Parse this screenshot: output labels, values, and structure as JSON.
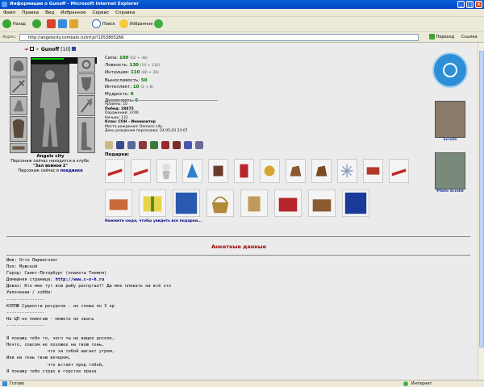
{
  "window": {
    "title": "Информация о Gunoff - Microsoft Internet Explorer"
  },
  "menu": [
    "Файл",
    "Правка",
    "Вид",
    "Избранное",
    "Сервис",
    "Справка"
  ],
  "toolbar": {
    "back": "Назад",
    "search": "Поиск",
    "favorites": "Избранное"
  },
  "address": {
    "label": "Адрес:",
    "url": "http://angelscity.combats.ru/inf.pl?1053803266",
    "go": "Переход",
    "links": "Ссылки"
  },
  "character": {
    "name": "Gunoff",
    "level": "[10]",
    "city": "Angels city",
    "club_line": "Персонаж сейчас находится в клубе.",
    "club_room": "\"Зал воинов 2\"",
    "location_line": "Персонаж сейчас в",
    "location_link": "поединке"
  },
  "stats": [
    {
      "label": "Сила:",
      "value": "100",
      "extra": "(62 + 38)"
    },
    {
      "label": "Ловкость:",
      "value": "130",
      "extra": "(14 + 116)"
    },
    {
      "label": "Интуиция:",
      "value": "110",
      "extra": "(80 + 30)"
    },
    {
      "label": "Выносливость:",
      "value": "50",
      "extra": ""
    },
    {
      "label": "Интеллект:",
      "value": "10",
      "extra": "(2 + 8)"
    },
    {
      "label": "Мудрость:",
      "value": "0",
      "extra": ""
    },
    {
      "label": "Духовность:",
      "value": "5",
      "extra": ""
    }
  ],
  "info": {
    "level": "Уровень: 10",
    "wins": "Побед: 28875",
    "losses": "Поражений: 3746",
    "draws": "Ничьих: 131",
    "clan": "Клан: COH - Инквизитор",
    "birthplace": "Место рождения: Demons city",
    "birthday": "День рождения персонажа: 24.05.03 23:07"
  },
  "gifts": {
    "label": "Подарки:",
    "link": "Нажмите сюда, чтобы увидеть все подарки..."
  },
  "rightpanel": {
    "scrolls": "Scrolls",
    "photo": "Photo Scrolls"
  },
  "anketa": {
    "title": "Анкетные данные",
    "name": "Имя: Отто Ларинголог",
    "sex": "Пол: Мужской",
    "city": "Город: Санкт-Петербург (планета Тнемля)",
    "homepage_label": "Домашняя страница: ",
    "homepage": "http://www.c-o-h.ru",
    "motto": "Девиз: Кто мне тут всю рыбу распугал?! Да мне плевать на всё это",
    "hobby": "Увлечения / хобби:",
    "lines": [
      "---------------",
      "КУПЛЮ Сущности ресурсов - не спеша по 3 кр",
      "---------------",
      "На ЦП не помогаю - можете не звать",
      "---------------",
      "",
      "Я покажу тебе то, чего ты не видел доселе,",
      "Нечто, совсем не похожее на твою тень,",
      "                что за тобой шагает утром,",
      "Или на тень твою вечером,",
      "                что встаёт пред тобой,",
      "Я покажу тебе страх в горстке праха"
    ]
  },
  "status": {
    "left": "Готово",
    "right": "Интернет"
  }
}
